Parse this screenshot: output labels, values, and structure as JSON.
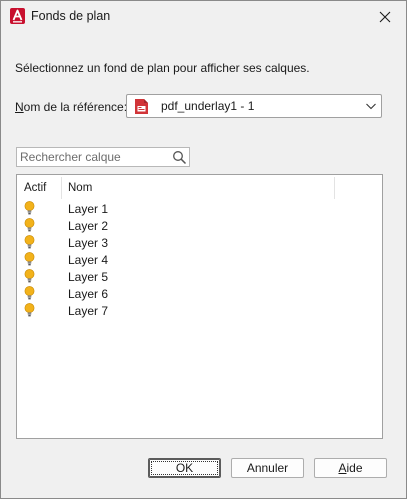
{
  "window": {
    "title": "Fonds de plan",
    "close_icon": "close-icon",
    "app_icon": "autocad-a-icon"
  },
  "instruction": "Sélectionnez un fond de plan pour afficher ses calques.",
  "reference": {
    "label_first": "N",
    "label_rest": "om de la référence:",
    "selected": "pdf_underlay1 - 1",
    "icon": "pdf-file-icon"
  },
  "search": {
    "placeholder": "Rechercher calque",
    "value": "",
    "icon": "search-icon"
  },
  "layers": {
    "columns": [
      "Actif",
      "Nom"
    ],
    "rows": [
      {
        "name": "Layer 1",
        "active": true
      },
      {
        "name": "Layer 2",
        "active": true
      },
      {
        "name": "Layer 3",
        "active": true
      },
      {
        "name": "Layer 4",
        "active": true
      },
      {
        "name": "Layer 5",
        "active": true
      },
      {
        "name": "Layer 6",
        "active": true
      },
      {
        "name": "Layer 7",
        "active": true
      }
    ]
  },
  "buttons": {
    "ok": "OK",
    "cancel": "Annuler",
    "help_first": "A",
    "help_rest": "ide"
  },
  "colors": {
    "bulb_on": "#f2b21b",
    "app_icon_red": "#c8102e",
    "pdf_red": "#d13438"
  }
}
